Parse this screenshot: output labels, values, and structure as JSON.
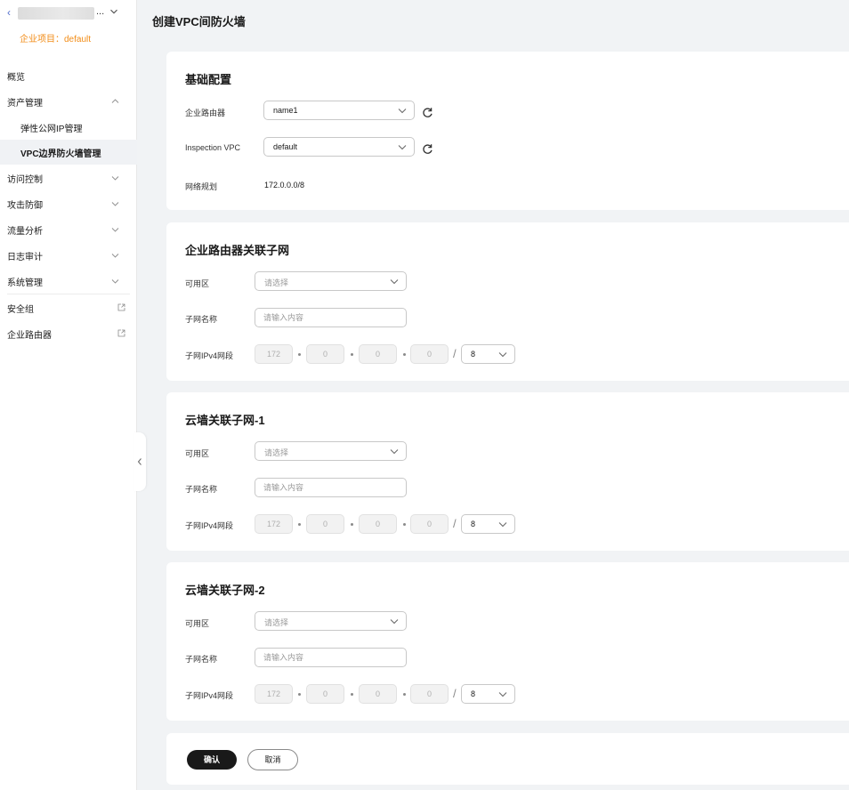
{
  "sidebar": {
    "project_label": "企业项目：default",
    "items": [
      {
        "label": "概览"
      },
      {
        "label": "资产管理"
      },
      {
        "label": "弹性公网IP管理"
      },
      {
        "label": "VPC边界防火墙管理"
      },
      {
        "label": "访问控制"
      },
      {
        "label": "攻击防御"
      },
      {
        "label": "流量分析"
      },
      {
        "label": "日志审计"
      },
      {
        "label": "系统管理"
      },
      {
        "label": "安全组"
      },
      {
        "label": "企业路由器"
      }
    ]
  },
  "header": {
    "title": "创建VPC间防火墙"
  },
  "basic": {
    "title": "基础配置",
    "router_label": "企业路由器",
    "router_value": "name1",
    "inspection_label": "Inspection VPC",
    "inspection_value": "default",
    "network_label": "网络规划",
    "network_value": "172.0.0.0/8"
  },
  "sections": [
    {
      "title": "企业路由器关联子网",
      "az_label": "可用区",
      "az_placeholder": "请选择",
      "name_label": "子网名称",
      "name_placeholder": "请输入内容",
      "cidr_label": "子网IPv4网段",
      "ip": [
        "172",
        "0",
        "0",
        "0"
      ],
      "mask": "8"
    },
    {
      "title": "云墙关联子网-1",
      "az_label": "可用区",
      "az_placeholder": "请选择",
      "name_label": "子网名称",
      "name_placeholder": "请输入内容",
      "cidr_label": "子网IPv4网段",
      "ip": [
        "172",
        "0",
        "0",
        "0"
      ],
      "mask": "8"
    },
    {
      "title": "云墙关联子网-2",
      "az_label": "可用区",
      "az_placeholder": "请选择",
      "name_label": "子网名称",
      "name_placeholder": "请输入内容",
      "cidr_label": "子网IPv4网段",
      "ip": [
        "172",
        "0",
        "0",
        "0"
      ],
      "mask": "8"
    }
  ],
  "footer": {
    "confirm_label": "确认",
    "cancel_label": "取消"
  },
  "colors": {
    "accent": "#191919",
    "project_label": "#f28c17",
    "active_nav_bg": "#f0f2f5",
    "page_bg": "#f1f3f5"
  }
}
